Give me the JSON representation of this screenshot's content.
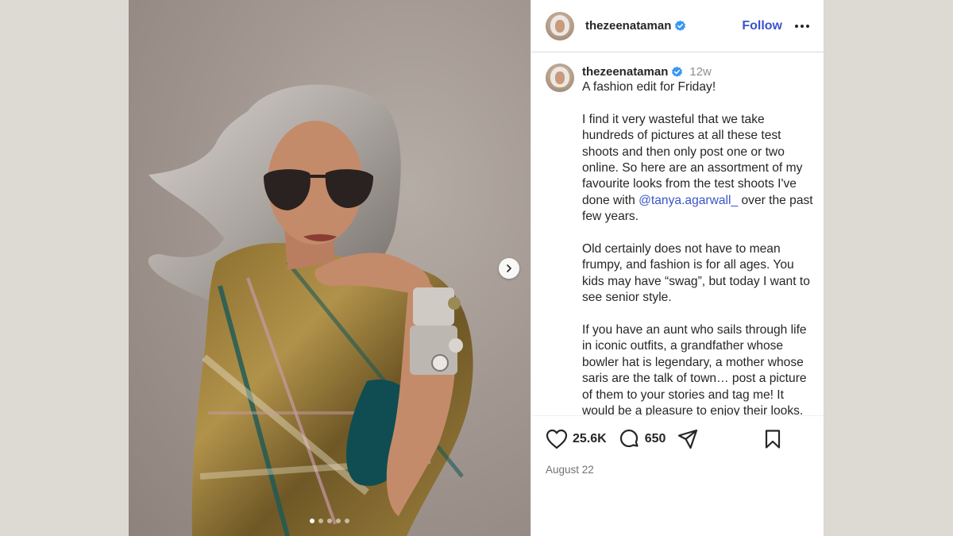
{
  "post": {
    "username": "thezeenataman",
    "verified": true,
    "follow_label": "Follow",
    "caption": {
      "username": "thezeenataman",
      "time": "12w",
      "line1": "A fashion edit for Friday!",
      "para2_before": "I find it very wasteful that we take hundreds of pictures at all these test shoots and then only post one or two online. So here are an assortment of my favourite looks from the test shoots I've done with ",
      "mention": "@tanya.agarwall_",
      "para2_after": " over the past few years.",
      "para3": "Old certainly does not have to mean frumpy, and fashion is for all ages. You kids may have “swag”, but today I want to see senior style.",
      "para4": "If you have an aunt who sails through life in iconic outfits, a grandfather whose bowler hat is legendary, a mother whose saris are the talk of town… post a picture of them to your stories and tag me! It would be a pleasure to enjoy their looks."
    },
    "likes": "25.6K",
    "comments": "650",
    "date": "August 22",
    "carousel": {
      "total": 5,
      "active_index": 1
    }
  },
  "colors": {
    "accent": "#3a55c9",
    "verified_badge": "#3897f0",
    "text": "#262626",
    "muted": "#8e8e8e"
  },
  "icons": [
    "next-arrow-icon",
    "verified-badge-icon",
    "more-icon",
    "heart-icon",
    "comment-icon",
    "share-icon",
    "bookmark-icon"
  ]
}
